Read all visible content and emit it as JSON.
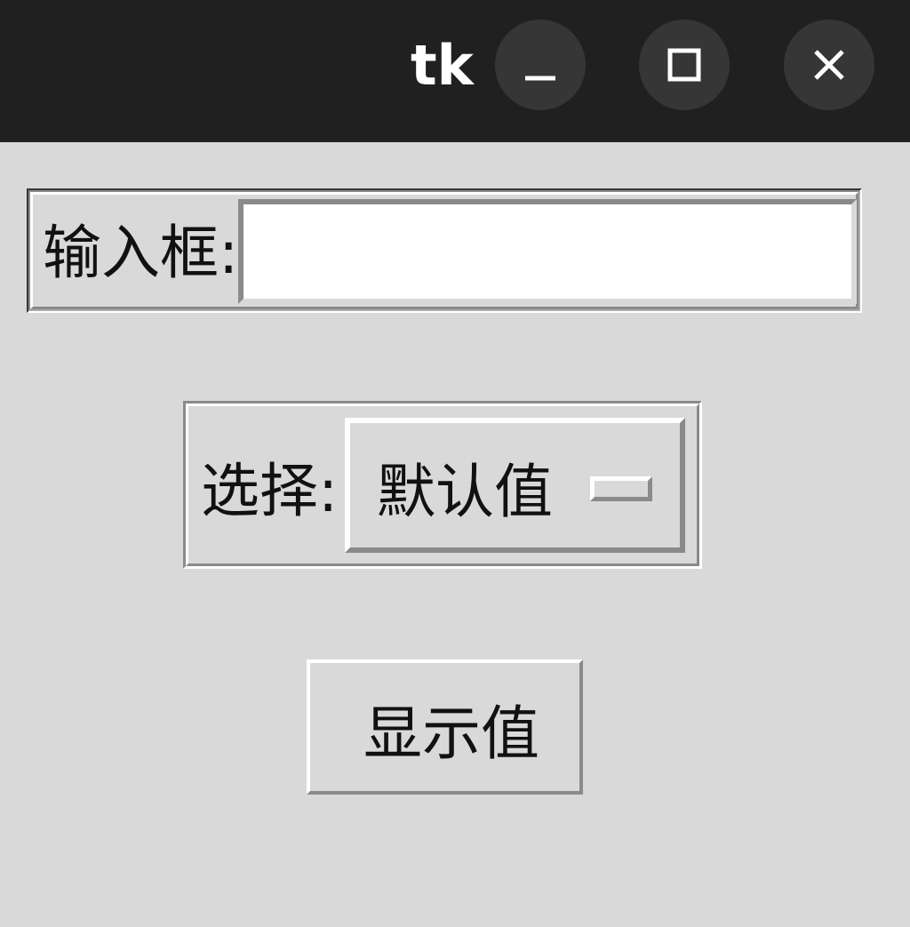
{
  "window": {
    "title": "tk",
    "controls": [
      "minimize-icon",
      "maximize-icon",
      "close-icon"
    ]
  },
  "form": {
    "entry_label": "输入框:",
    "entry_value": "",
    "select_label": "选择:",
    "select_value": "默认值",
    "button_label": "显示值"
  },
  "colors": {
    "titlebar": "#202020",
    "background": "#d9d9d9",
    "entry_bg": "#ffffff"
  }
}
